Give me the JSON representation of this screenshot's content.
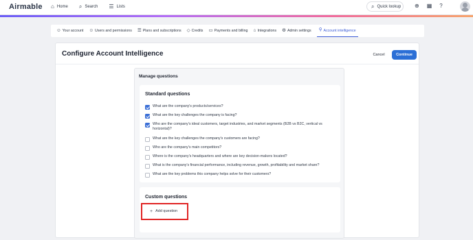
{
  "app": {
    "logo": "Airmable"
  },
  "topnav": [
    {
      "icon": "⌂",
      "label": "Home"
    },
    {
      "icon": "⌕",
      "label": "Search"
    },
    {
      "icon": "☰",
      "label": "Lists"
    }
  ],
  "quick_lookup": {
    "icon": "⌕",
    "label": "Quick lookup"
  },
  "top_icons": {
    "download": "⊕",
    "calendar": "▦",
    "help": "?"
  },
  "tabs": [
    {
      "icon": "☺",
      "label": "Your account"
    },
    {
      "icon": "☺",
      "label": "Users and permissions"
    },
    {
      "icon": "☰",
      "label": "Plans and subscriptions"
    },
    {
      "icon": "◇",
      "label": "Credits"
    },
    {
      "icon": "▭",
      "label": "Payments and billing"
    },
    {
      "icon": "⌂",
      "label": "Integrations"
    },
    {
      "icon": "⚙",
      "label": "Admin settings"
    },
    {
      "icon": "⚲",
      "label": "Account intelligence",
      "active": true
    }
  ],
  "page": {
    "title": "Configure Account Intelligence",
    "cancel": "Cancel",
    "continue": "Continue"
  },
  "manage": {
    "title": "Manage questions",
    "standard_title": "Standard questions",
    "questions": [
      {
        "text": "What are the company's products/services?",
        "checked": true
      },
      {
        "text": "What are the key challenges the company is facing?",
        "checked": true
      },
      {
        "text": "Who are the company's ideal customers, target industries, and market segments (B2B vs B2C, vertical vs horizontal)?",
        "checked": true
      },
      {
        "text": "What are the key challenges the company's customers are facing?",
        "checked": false
      },
      {
        "text": "Who are the company's main competitors?",
        "checked": false
      },
      {
        "text": "Where is the company's headquarters and where are key decision-makers located?",
        "checked": false
      },
      {
        "text": "What is the company's financial performance, including revenue, growth, profitability and market share?",
        "checked": false
      },
      {
        "text": "What are the key problems this company helps solve for their customers?",
        "checked": false
      }
    ],
    "custom_title": "Custom questions",
    "add_question": "Add question"
  },
  "colors": {
    "accent": "#2b6fd6",
    "highlight": "#e02222"
  }
}
